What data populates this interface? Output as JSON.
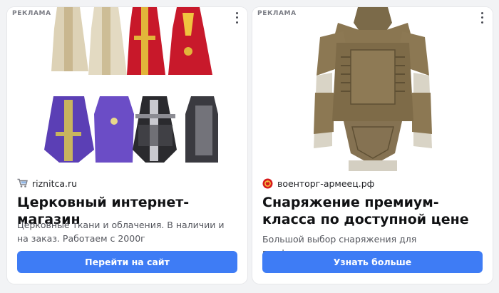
{
  "ads": [
    {
      "ad_label": "РЕКЛАМА",
      "image_icon": "vestments-photo",
      "favicon": "shopping-cart-icon",
      "domain": "riznitca.ru",
      "title": "Церковный интернет-магазин",
      "description": "Церковные ткани и облачения. В наличии и на заказ. Работаем с 2000г",
      "cta_label": "Перейти на сайт"
    },
    {
      "ad_label": "РЕКЛАМА",
      "image_icon": "tactical-vest-photo",
      "favicon": "red-emblem-icon",
      "domain": "военторг-армеец.рф",
      "title": "Снаряжение премиум-класса по доступной цене",
      "description": "Большой выбор снаряжения для профессионалов.",
      "cta_label": "Узнать больше"
    }
  ],
  "colors": {
    "page_bg": "#f2f3f5",
    "card_bg": "#ffffff",
    "button_bg": "#3e7cf5",
    "button_text": "#ffffff"
  }
}
